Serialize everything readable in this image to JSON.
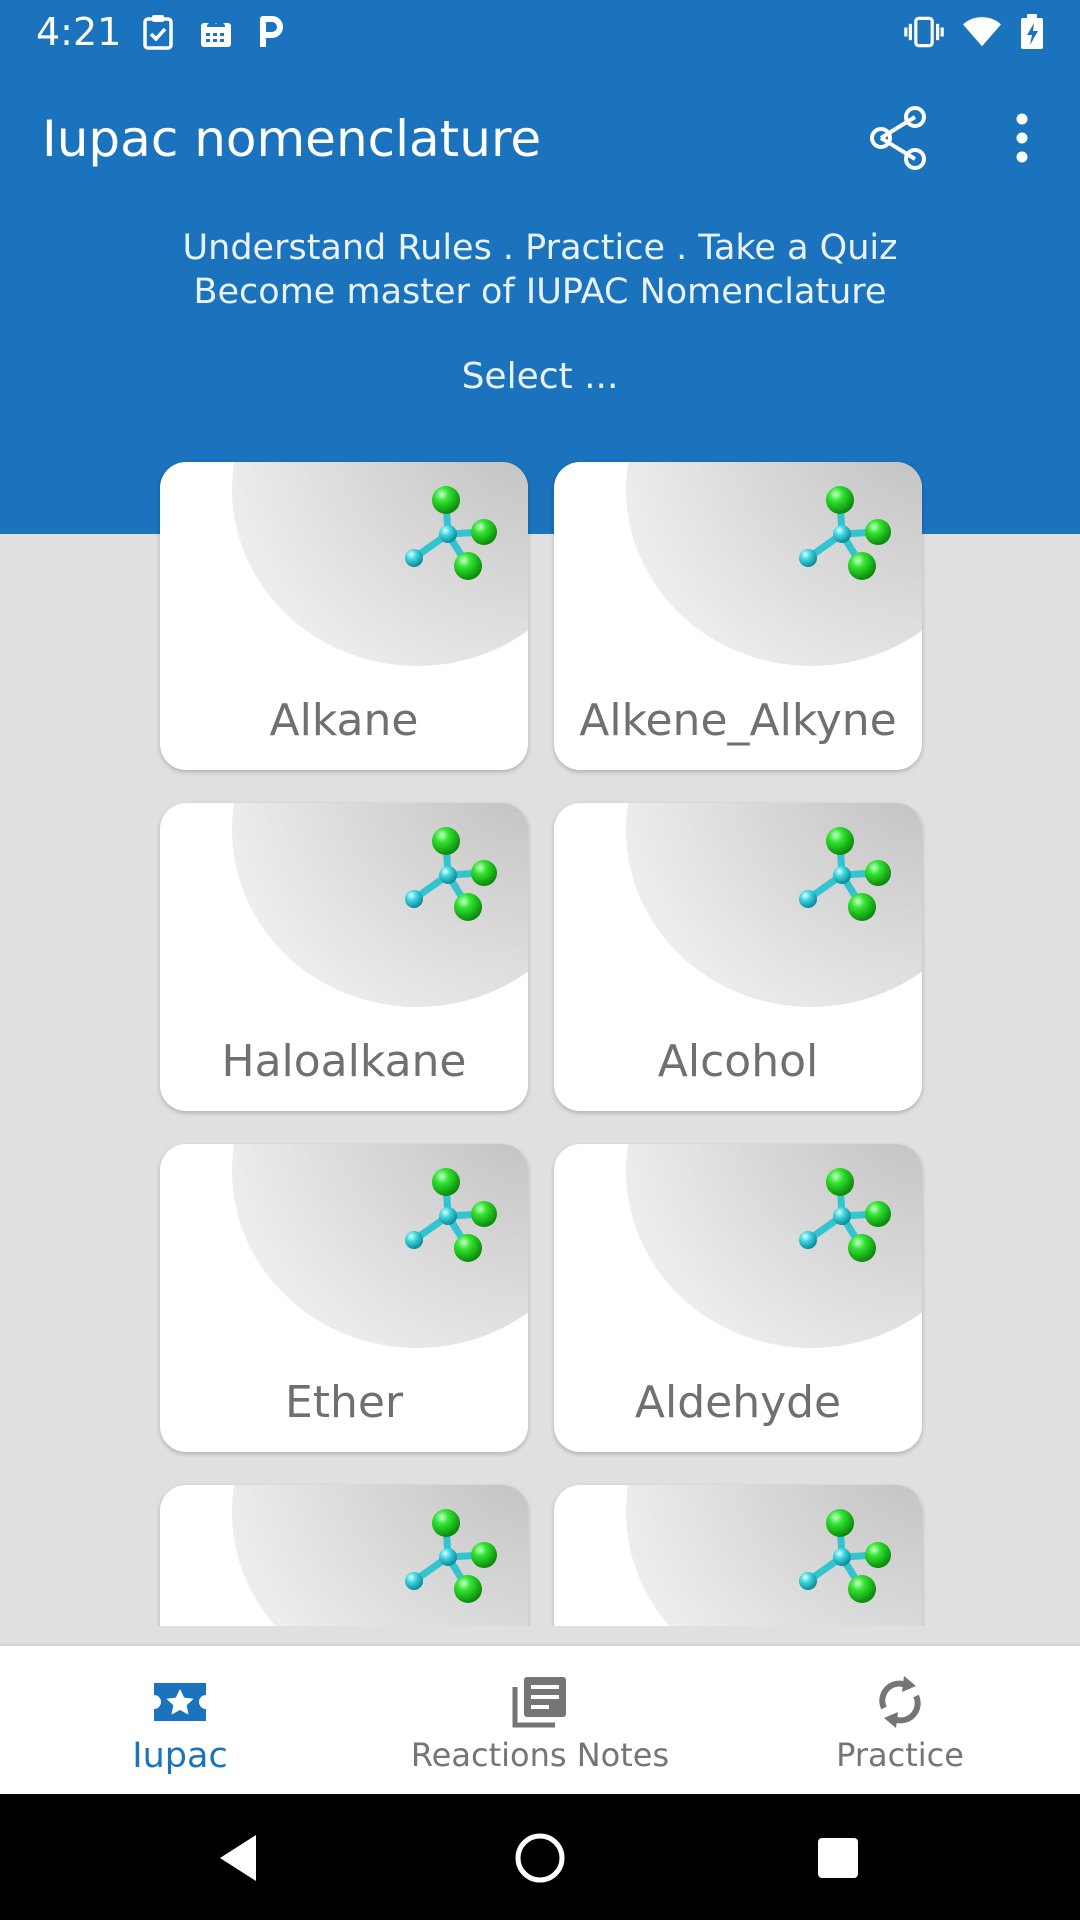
{
  "status_bar": {
    "time": "4:21",
    "left_icons": [
      "clipboard-check-icon",
      "cloud-calendar-icon",
      "p-letter-icon"
    ],
    "right_icons": [
      "vibrate-icon",
      "wifi-icon",
      "battery-charging-icon"
    ]
  },
  "app_bar": {
    "title": "Iupac nomenclature",
    "actions": [
      "share-icon",
      "more-vert-icon"
    ]
  },
  "tagline": {
    "line1": "Understand Rules . Practice . Take a Quiz",
    "line2": "Become master of IUPAC Nomenclature"
  },
  "select_label": "Select ...",
  "categories": [
    {
      "label": "Alkane"
    },
    {
      "label": "Alkene_Alkyne"
    },
    {
      "label": "Haloalkane"
    },
    {
      "label": "Alcohol"
    },
    {
      "label": "Ether"
    },
    {
      "label": "Aldehyde"
    },
    {
      "label": ""
    },
    {
      "label": ""
    }
  ],
  "bottom_nav": {
    "selected": "iupac",
    "items": [
      {
        "label": "Iupac",
        "icon": "star-ticket-icon"
      },
      {
        "label": "Reactions Notes",
        "icon": "notes-stack-icon"
      },
      {
        "label": "Practice",
        "icon": "refresh-icon"
      }
    ]
  },
  "colors": {
    "primary": "#1a73bc",
    "background": "#e0e0e0",
    "card": "#ffffff",
    "label": "#707070",
    "molecule_ball": "#22dd22",
    "molecule_bond": "#33c4d0"
  }
}
